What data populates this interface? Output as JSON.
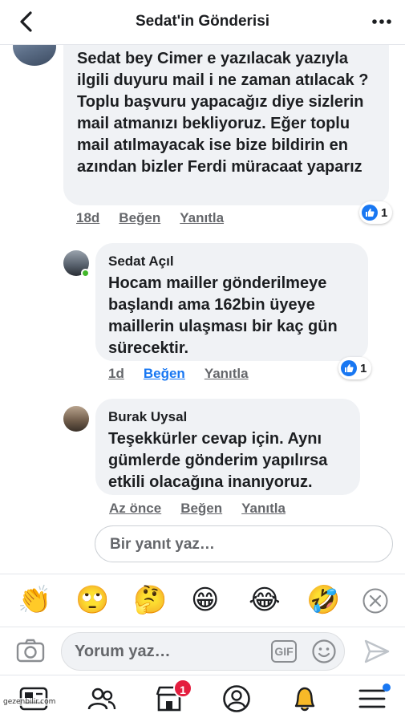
{
  "header": {
    "title": "Sedat'in Gönderisi"
  },
  "comments": [
    {
      "author": "",
      "text": "Sedat bey Cimer e yazılacak yazıyla ilgili duyuru mail i ne zaman atılacak ? Toplu başvuru yapacağız diye sizlerin mail atmanızı bekliyoruz. Eğer toplu mail atılmayacak ise bize bildirin en azından bizler Ferdi müracaat yaparız",
      "time": "18d",
      "like": "Beğen",
      "reply": "Yanıtla",
      "reactions": "1"
    },
    {
      "author": "Sedat Açıl",
      "text": "Hocam mailler gönderilmeye başlandı ama 162bin üyeye maillerin ulaşması bir kaç gün sürecektir.",
      "time": "1d",
      "like": "Beğen",
      "reply": "Yanıtla",
      "reactions": "1"
    },
    {
      "author": "Burak Uysal",
      "text": "Teşekkürler cevap için. Aynı gümlerde gönderim yapılırsa etkili olacağına inanıyoruz.",
      "time": "Az önce",
      "like": "Beğen",
      "reply": "Yanıtla"
    }
  ],
  "reply_placeholder": "Bir yanıt yaz…",
  "emoji_bar": [
    "👏",
    "🙄",
    "🤔",
    "😁",
    "😂",
    "🤣"
  ],
  "composer": {
    "placeholder": "Yorum yaz…",
    "gif_label": "GIF"
  },
  "nav": {
    "notification_count": "1"
  },
  "watermark": "gezenbilir.com",
  "colors": {
    "accent": "#1877f2",
    "bubble": "#f0f2f5",
    "badge": "#e41e3f"
  }
}
